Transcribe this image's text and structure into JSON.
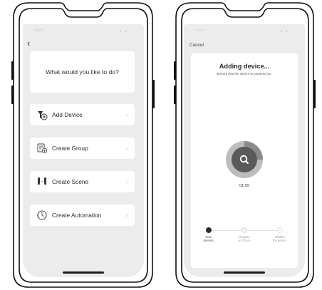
{
  "left_screen": {
    "prompt": "What would you like to do?",
    "menu": [
      {
        "label": "Add Device",
        "icon": "add-device-icon",
        "chevron": "›"
      },
      {
        "label": "Create Group",
        "icon": "create-group-icon",
        "chevron": "›"
      },
      {
        "label": "Create Scene",
        "icon": "create-scene-icon",
        "chevron": "›"
      },
      {
        "label": "Create Automation",
        "icon": "create-automation-icon",
        "chevron": "›"
      }
    ],
    "back_glyph": "‹"
  },
  "right_screen": {
    "cancel_label": "Cancel",
    "title": "Adding device...",
    "subtitle": "Ensure that the device is powered on.",
    "timer": "01:59",
    "progress_ring_fraction": 0.25,
    "steps": [
      {
        "label_line1": "Scan",
        "label_line2": "devices.",
        "state": "active"
      },
      {
        "label_line1": "Register",
        "label_line2": "on Cloud.",
        "state": "pending"
      },
      {
        "label_line1": "Initialize",
        "label_line2": "the device.",
        "state": "pending"
      }
    ]
  },
  "colors": {
    "screen_bg": "#ececec",
    "card_bg": "#ffffff",
    "ring_dark": "#5a5a5a",
    "ring_light": "#bdbdbd",
    "step_active": "#2c2c2c"
  }
}
